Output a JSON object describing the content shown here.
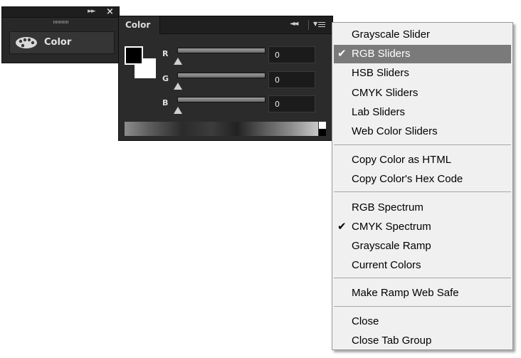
{
  "dock": {
    "item_label": "Color"
  },
  "panel": {
    "tab_label": "Color",
    "channels": [
      {
        "label": "R",
        "value": "0"
      },
      {
        "label": "G",
        "value": "0"
      },
      {
        "label": "B",
        "value": "0"
      }
    ],
    "foreground_color": "#000000",
    "background_color": "#ffffff"
  },
  "menu": {
    "items": [
      {
        "label": "Grayscale Slider",
        "checked": false
      },
      {
        "label": "RGB Sliders",
        "checked": true,
        "highlighted": true
      },
      {
        "label": "HSB Sliders",
        "checked": false
      },
      {
        "label": "CMYK Sliders",
        "checked": false
      },
      {
        "label": "Lab Sliders",
        "checked": false
      },
      {
        "label": "Web Color Sliders",
        "checked": false
      },
      {
        "label": "Copy Color as HTML",
        "checked": false
      },
      {
        "label": "Copy Color's Hex Code",
        "checked": false
      },
      {
        "label": "RGB Spectrum",
        "checked": false
      },
      {
        "label": "CMYK Spectrum",
        "checked": true
      },
      {
        "label": "Grayscale Ramp",
        "checked": false
      },
      {
        "label": "Current Colors",
        "checked": false
      },
      {
        "label": "Make Ramp Web Safe",
        "checked": false
      },
      {
        "label": "Close",
        "checked": false
      },
      {
        "label": "Close Tab Group",
        "checked": false
      }
    ],
    "check_glyph": "✔",
    "highlight_color": "#7a7a7a"
  }
}
